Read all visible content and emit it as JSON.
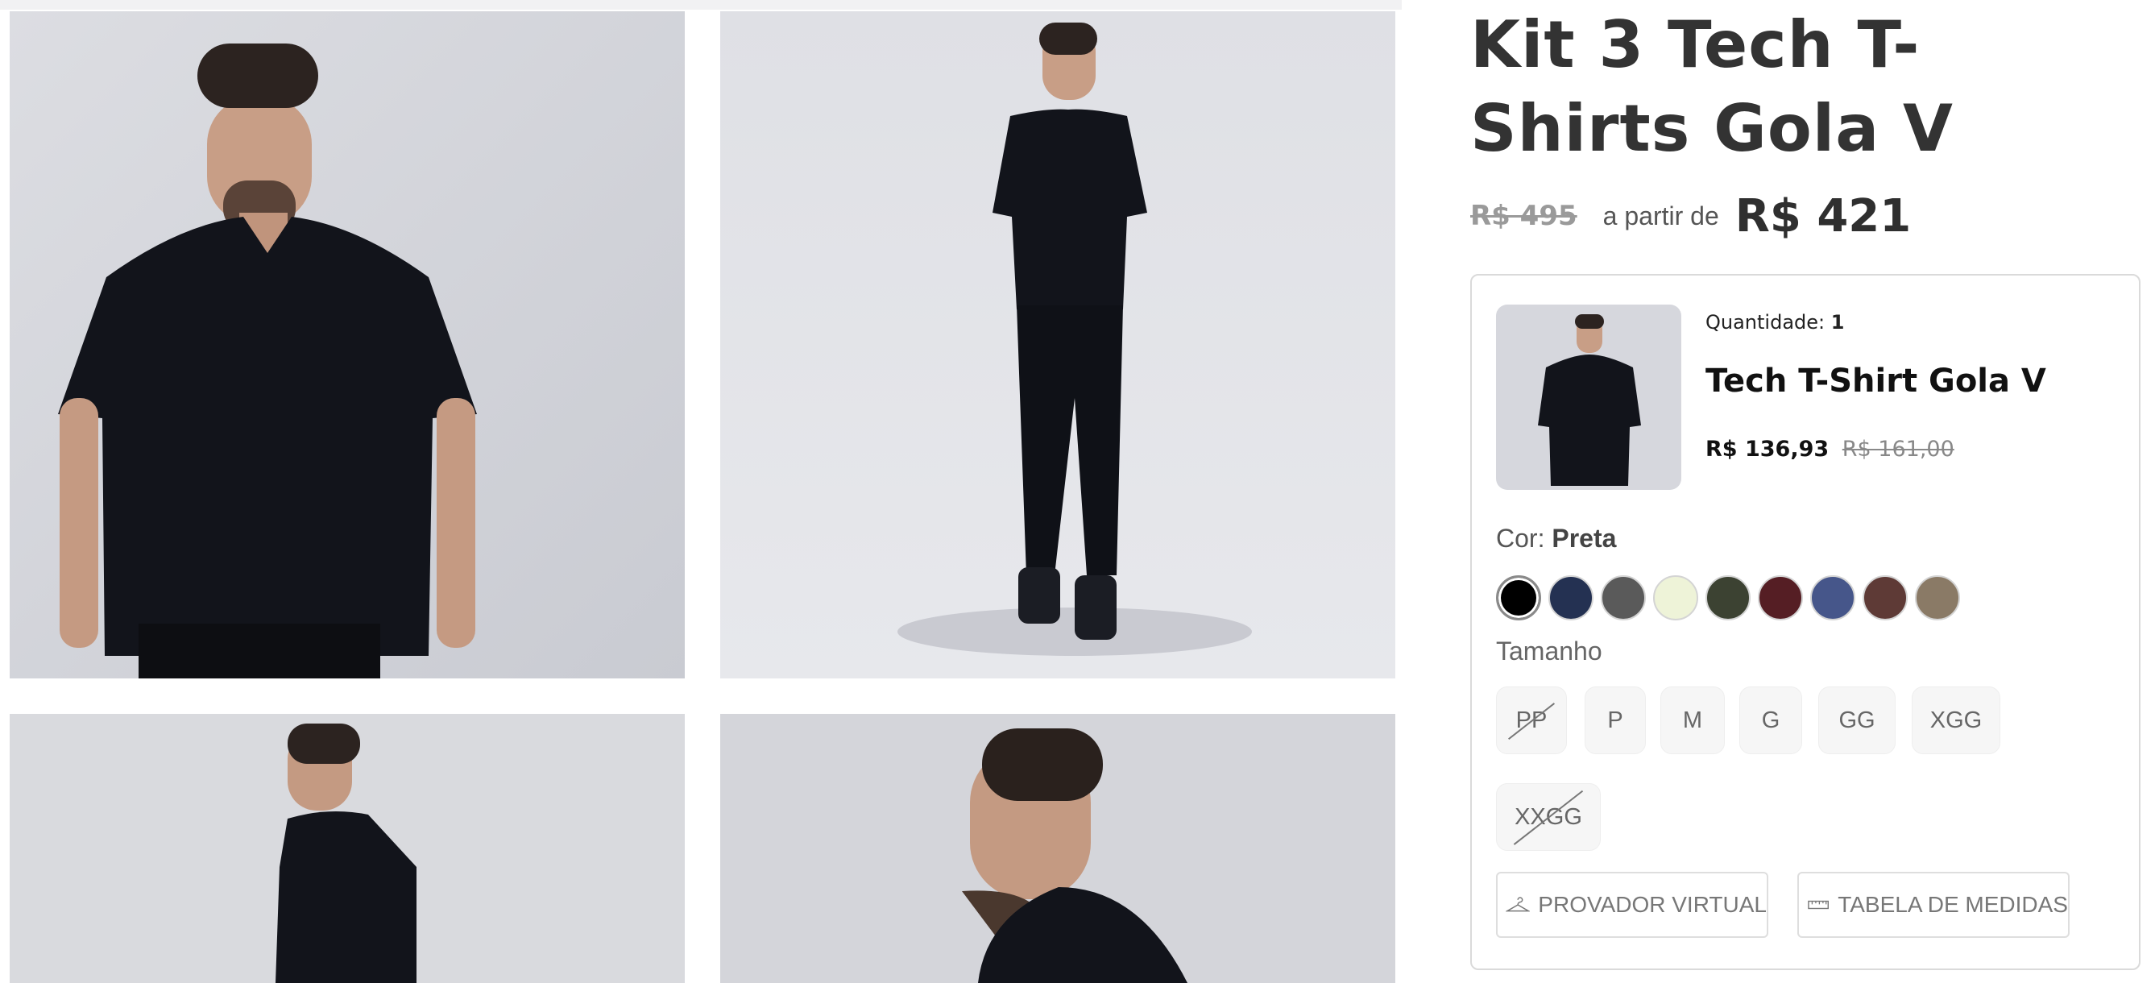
{
  "product": {
    "title": "Kit 3 Tech T-Shirts Gola V",
    "old_price": "R$ 495",
    "from_label": "a partir de",
    "price": "R$ 421"
  },
  "gallery": {
    "images": [
      "front-view-photo",
      "full-body-photo",
      "back-view-photo",
      "side-profile-photo"
    ]
  },
  "kit_item": {
    "quantity_label": "Quantidade:",
    "quantity_value": "1",
    "name": "Tech T-Shirt Gola V",
    "price": "R$ 136,93",
    "old_price": "R$ 161,00"
  },
  "color": {
    "label": "Cor:",
    "selected": "Preta",
    "swatches": [
      "#000000",
      "#243152",
      "#5a5a5a",
      "#eef3d8",
      "#3c4232",
      "#551e24",
      "#46568a",
      "#5e3a36",
      "#8a7a66"
    ]
  },
  "size": {
    "label": "Tamanho",
    "options": [
      {
        "label": "PP",
        "available": false
      },
      {
        "label": "P",
        "available": true
      },
      {
        "label": "M",
        "available": true
      },
      {
        "label": "G",
        "available": true
      },
      {
        "label": "GG",
        "available": true
      },
      {
        "label": "XGG",
        "available": true
      },
      {
        "label": "XXGG",
        "available": false
      }
    ]
  },
  "tools": {
    "virtual_fitting": "PROVADOR VIRTUAL",
    "size_chart": "TABELA DE MEDIDAS"
  }
}
